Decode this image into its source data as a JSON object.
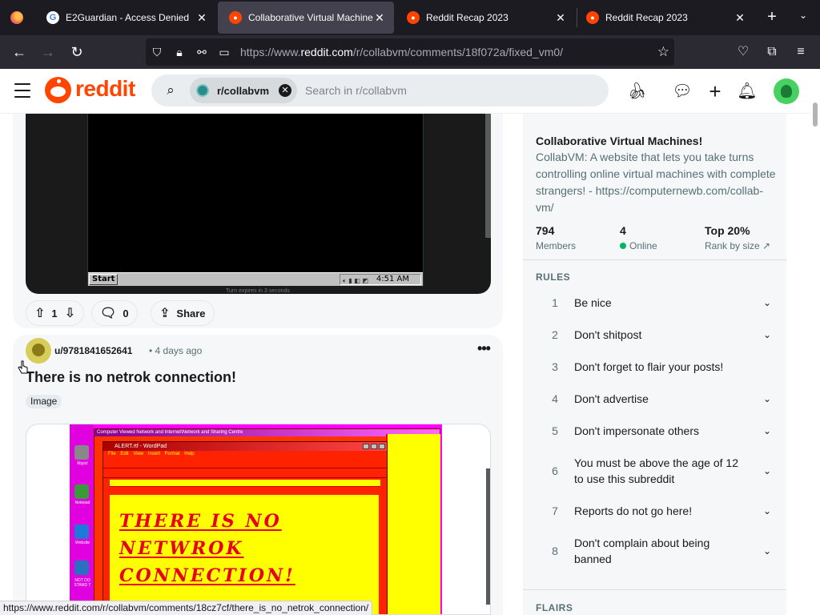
{
  "browser": {
    "tabs": [
      {
        "label": "E2Guardian - Access Denied",
        "favicon": "G"
      },
      {
        "label": "Collaborative Virtual Machines!",
        "favicon": "reddit"
      },
      {
        "label": "Reddit Recap 2023",
        "favicon": "reddit"
      },
      {
        "label": "Reddit Recap 2023",
        "favicon": "reddit"
      }
    ],
    "url_prefix": "https://www.",
    "url_domain": "reddit.com",
    "url_path": "/r/collabvm/comments/18f072a/fixed_vm0/",
    "status_url": "https://www.reddit.com/r/collabvm/comments/18cz7cf/there_is_no_netrok_connection/",
    "colors": {
      "tab_bg": "#1c1b22",
      "active_tab": "#42414d",
      "toolbar": "#2b2a33"
    }
  },
  "header": {
    "logo_text": "reddit",
    "search_chip": "r/collabvm",
    "search_placeholder": "Search in r/collabvm",
    "brand_color": "#ff4500"
  },
  "post1": {
    "vm_time": "4:51 AM",
    "vm_start": "Start",
    "vm_caption": "Turn expires in 3 seconds",
    "votes": "1",
    "comments": "0",
    "share_label": "Share"
  },
  "post2": {
    "author": "u/9781841652641",
    "age": "• 4 days ago",
    "title": "There is no netrok connection!",
    "flair": "Image",
    "image": {
      "explorer_title": "Computer  Viewed Network and Internet\\Network and Sharing Centre",
      "wordpad_title": "ALERT.rtf - WordPad",
      "menu": "File Edit View Insert Format Help",
      "desktop_icons": [
        "Mypct",
        "Notepad",
        "Website",
        "NOT DO STAND T"
      ],
      "message_lines": [
        "THERE IS NO",
        "NETWROK",
        "CONNECTION!"
      ]
    }
  },
  "sidebar": {
    "title": "Collaborative Virtual Machines!",
    "description": "CollabVM: A website that lets you take turns controlling online virtual machines with complete strangers! - https://computernewb.com/collab-vm/",
    "stats": [
      {
        "value": "794",
        "label": "Members"
      },
      {
        "value": "4",
        "label": "Online"
      },
      {
        "value": "Top 20%",
        "label": "Rank by size"
      }
    ],
    "rules_heading": "RULES",
    "rules": [
      {
        "n": "1",
        "text": "Be nice",
        "chevron": true
      },
      {
        "n": "2",
        "text": "Don't shitpost",
        "chevron": true
      },
      {
        "n": "3",
        "text": "Don't forget to flair your posts!",
        "chevron": false
      },
      {
        "n": "4",
        "text": "Don't advertise",
        "chevron": true
      },
      {
        "n": "5",
        "text": "Don't impersonate others",
        "chevron": true
      },
      {
        "n": "6",
        "text": "You must be above the age of 12 to use this subreddit",
        "chevron": true
      },
      {
        "n": "7",
        "text": "Reports do not go here!",
        "chevron": true
      },
      {
        "n": "8",
        "text": "Don't complain about being banned",
        "chevron": true
      }
    ],
    "flairs_heading": "FLAIRS"
  }
}
